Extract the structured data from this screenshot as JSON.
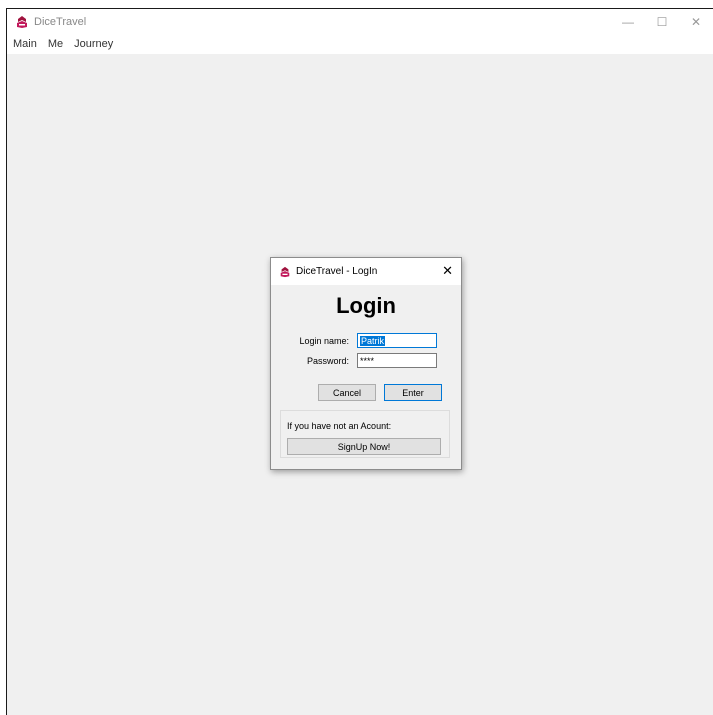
{
  "window": {
    "title": "DiceTravel",
    "controls": {
      "minimize": "—",
      "maximize": "☐",
      "close": "✕"
    }
  },
  "menu": [
    "Main",
    "Me",
    "Journey"
  ],
  "dialog": {
    "title": "DiceTravel - LogIn",
    "close": "✕",
    "heading": "Login",
    "login_label": "Login name:",
    "login_value": "Patrik",
    "password_label": "Password:",
    "password_value": "****",
    "cancel_label": "Cancel",
    "enter_label": "Enter",
    "signup_prompt": "If you have not an Acount:",
    "signup_label": "SignUp Now!"
  },
  "colors": {
    "accent": "#0078d7",
    "icon": "#a0123e"
  },
  "icons": {
    "app": "dice-icon"
  }
}
